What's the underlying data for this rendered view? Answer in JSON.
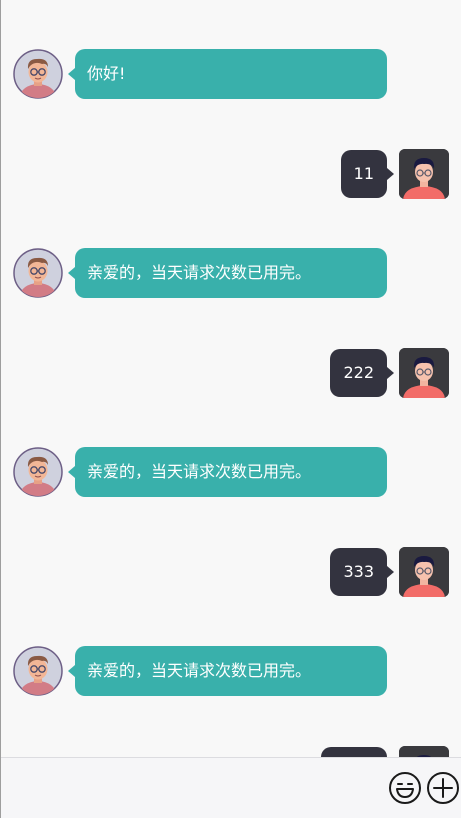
{
  "messages": [
    {
      "from": "bot",
      "text": "你好!"
    },
    {
      "from": "user",
      "text": "11"
    },
    {
      "from": "bot",
      "text": "亲爱的，当天请求次数已用完。"
    },
    {
      "from": "user",
      "text": "222"
    },
    {
      "from": "bot",
      "text": "亲爱的，当天请求次数已用完。"
    },
    {
      "from": "user",
      "text": "333"
    },
    {
      "from": "bot",
      "text": "亲爱的，当天请求次数已用完。"
    },
    {
      "from": "user",
      "text": ""
    }
  ],
  "input": {
    "value": "",
    "placeholder": ""
  },
  "toolbar": {
    "emoji_icon": "emoji-icon",
    "plus_icon": "plus-circle-icon"
  },
  "colors": {
    "bot_bubble": "#39b0ab",
    "user_bubble": "#33333f",
    "background": "#f8f8f8",
    "user_shirt": "#f26c68",
    "bot_shirt": "#d27c86"
  }
}
